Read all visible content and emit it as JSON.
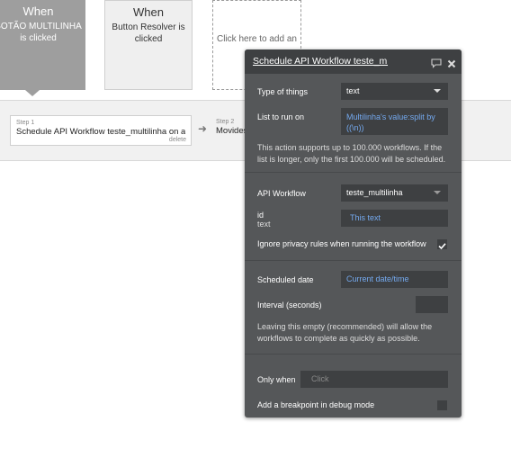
{
  "events": [
    {
      "when": "When",
      "text": "BOTÃO MULTILINHA is clicked"
    },
    {
      "when": "When",
      "text": "Button Resolver is clicked"
    },
    {
      "placeholder": "Click here to add an"
    }
  ],
  "steps": [
    {
      "num": "Step 1",
      "text": "Schedule API Workflow teste_multilinha on a list",
      "delete": "delete"
    },
    {
      "num": "Step 2",
      "text": "Movides"
    }
  ],
  "panel": {
    "title": "Schedule API Workflow teste_mı",
    "type_label": "Type of things",
    "type_value": "text",
    "list_label": "List to run on",
    "list_value_line1": "Multilinha's value:split by",
    "list_value_line2": "((\\n))",
    "info_line1": "This action supports up to 100.000 workflows. If the",
    "info_line2": "list is longer, only the first 100.000 will be scheduled.",
    "api_label": "API Workflow",
    "api_value": "teste_multilinha",
    "param_name": "id",
    "param_type": "text",
    "param_value": "This text",
    "privacy_label": "Ignore privacy rules when running the workflow",
    "privacy_checked": true,
    "date_label": "Scheduled date",
    "date_value": "Current date/time",
    "interval_label": "Interval (seconds)",
    "interval_value": "",
    "interval_hint_line1": "Leaving this empty (recommended) will allow the",
    "interval_hint_line2": "workflows to complete as quickly as possible.",
    "only_when_label": "Only when",
    "only_when_placeholder": "Click",
    "breakpoint_label": "Add a breakpoint in debug mode",
    "breakpoint_checked": false
  },
  "colors": {
    "dynamic_value": "#74a9ef",
    "panel_bg": "#555759",
    "field_bg": "#3e4042"
  },
  "icons": {
    "comment": "comment-icon",
    "close": "close-icon",
    "arrow": "arrow-right-icon",
    "check": "check-icon"
  }
}
